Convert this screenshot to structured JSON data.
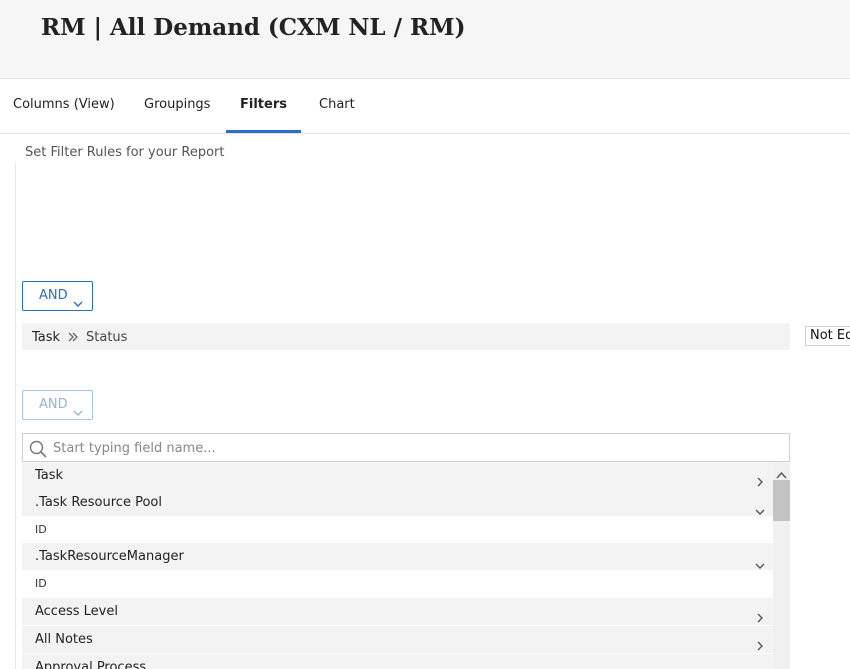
{
  "header": {
    "title": "RM | All Demand (CXM NL / RM)"
  },
  "tabs": [
    {
      "label": "Columns (View)"
    },
    {
      "label": "Groupings"
    },
    {
      "label": "Filters"
    },
    {
      "label": "Chart"
    }
  ],
  "filters": {
    "subtitle": "Set Filter Rules for your Report",
    "logic_primary": "AND",
    "rule": {
      "field_path": [
        "Task",
        "Status"
      ],
      "operator": "Not Equal"
    },
    "logic_secondary": "AND",
    "search": {
      "placeholder": "Start typing field name...",
      "value": ""
    },
    "field_list": [
      {
        "label": "Task",
        "kind": "group",
        "state": "collapsed"
      },
      {
        "label": ".Task Resource Pool",
        "kind": "group",
        "state": "expanded"
      },
      {
        "label": "ID",
        "kind": "child"
      },
      {
        "label": ".TaskResourceManager",
        "kind": "group",
        "state": "expanded"
      },
      {
        "label": "ID",
        "kind": "child"
      },
      {
        "label": "Access Level",
        "kind": "group",
        "state": "collapsed"
      },
      {
        "label": "All Notes",
        "kind": "group",
        "state": "collapsed"
      },
      {
        "label": "Approval Process",
        "kind": "group",
        "state": "collapsed"
      }
    ]
  },
  "colors": {
    "accent": "#2f6bd6",
    "button_border": "#2d6fb5"
  }
}
